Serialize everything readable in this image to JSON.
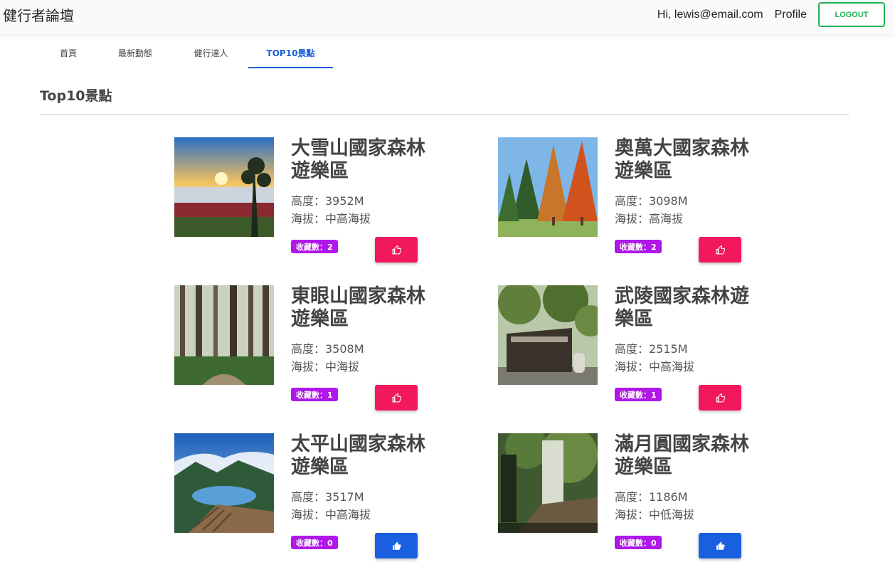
{
  "header": {
    "brand": "健行者論壇",
    "greeting": "Hi, lewis@email.com",
    "profile": "Profile",
    "logout": "LOGOUT"
  },
  "tabs": [
    {
      "label": "首頁",
      "active": false
    },
    {
      "label": "最新動態",
      "active": false
    },
    {
      "label": "健行達人",
      "active": false
    },
    {
      "label": "TOP10景點",
      "active": true
    }
  ],
  "section": {
    "title": "Top10景點"
  },
  "spots": [
    {
      "name": "大雪山國家森林遊樂區",
      "height": "高度：3952M",
      "altitude": "海拔：中高海拔",
      "favorites": "收藏數：2",
      "liked": false
    },
    {
      "name": "奧萬大國家森林遊樂區",
      "height": "高度：3098M",
      "altitude": "海拔：高海拔",
      "favorites": "收藏數：2",
      "liked": false
    },
    {
      "name": "東眼山國家森林遊樂區",
      "height": "高度：3508M",
      "altitude": "海拔：中海拔",
      "favorites": "收藏數：1",
      "liked": false
    },
    {
      "name": "武陵國家森林遊樂區",
      "height": "高度：2515M",
      "altitude": "海拔：中高海拔",
      "favorites": "收藏數：1",
      "liked": false
    },
    {
      "name": "太平山國家森林遊樂區",
      "height": "高度：3517M",
      "altitude": "海拔：中高海拔",
      "favorites": "收藏數：0",
      "liked": true
    },
    {
      "name": "滿月圓國家森林遊樂區",
      "height": "高度：1186M",
      "altitude": "海拔：中低海拔",
      "favorites": "收藏數：0",
      "liked": true
    }
  ],
  "colors": {
    "like_default": "#f2185c",
    "like_active": "#1a5fe0",
    "badge": "#b017e8",
    "accent": "#1a5fd6",
    "logout": "#1fb157"
  },
  "icons": {
    "like": "thumbs-up-icon"
  }
}
